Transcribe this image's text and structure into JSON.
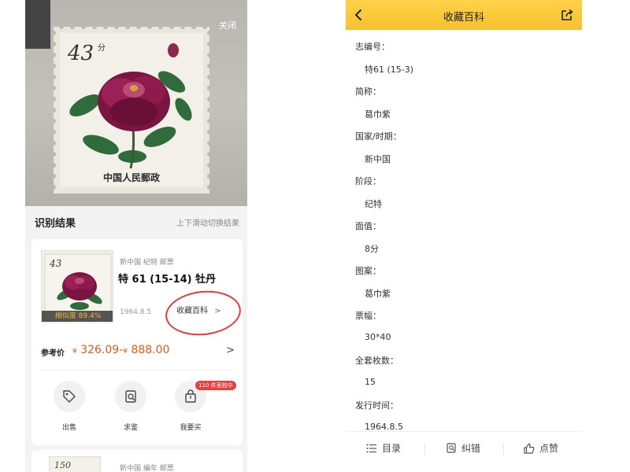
{
  "left": {
    "close_label": "关闭",
    "stamp": {
      "denomination": "43",
      "unit_glyph": "分",
      "country_text": "中国人民郵政"
    },
    "result_title": "识别结果",
    "result_hint": "上下滑动切换结果",
    "card1": {
      "thumb_denomination": "43",
      "similarity": "相似度 89.4%",
      "meta": "新中国 纪特 邮票",
      "name": "特 61 (15-14) 牡丹",
      "date": "1964.8.5",
      "encyclopedia_button": "收藏百科",
      "encyclopedia_arrow": ">",
      "ref_label": "参考价",
      "price_low_yen": "¥",
      "price_low": "326.09",
      "price_dash": "-",
      "price_high_yen": "¥",
      "price_high": "888.00",
      "ref_arrow": ">",
      "actions": [
        {
          "label": "出售",
          "icon": "tag-icon"
        },
        {
          "label": "求鉴",
          "icon": "appraise-icon"
        },
        {
          "label": "我要买",
          "icon": "shopping-bag-icon"
        }
      ],
      "bid_badge": "110 件竞拍中"
    },
    "card2": {
      "thumb_denomination": "150",
      "meta": "新中国 编年 邮票"
    }
  },
  "right": {
    "topbar": {
      "title": "收藏百科",
      "back_icon": "back-arrow-icon",
      "share_icon": "share-icon"
    },
    "fields": [
      {
        "label": "志编号：",
        "value": "特61 (15-3)"
      },
      {
        "label": "简称：",
        "value": "葛巾紫"
      },
      {
        "label": "国家/时期：",
        "value": "新中国"
      },
      {
        "label": "阶段：",
        "value": "纪特"
      },
      {
        "label": "面值：",
        "value": "8分"
      },
      {
        "label": "图案：",
        "value": "葛巾紫"
      },
      {
        "label": "票幅：",
        "value": "30*40"
      },
      {
        "label": "全套枚数：",
        "value": "15"
      },
      {
        "label": "发行时间：",
        "value": "1964.8.5"
      }
    ],
    "bottombar": {
      "catalog": "目录",
      "correct": "纠错",
      "like": "点赞"
    }
  },
  "colors": {
    "brand_yellow": "#f7c12f",
    "price_orange": "#e05a1a",
    "badge_red": "#e64040",
    "annotation_red": "#e23b3b"
  }
}
